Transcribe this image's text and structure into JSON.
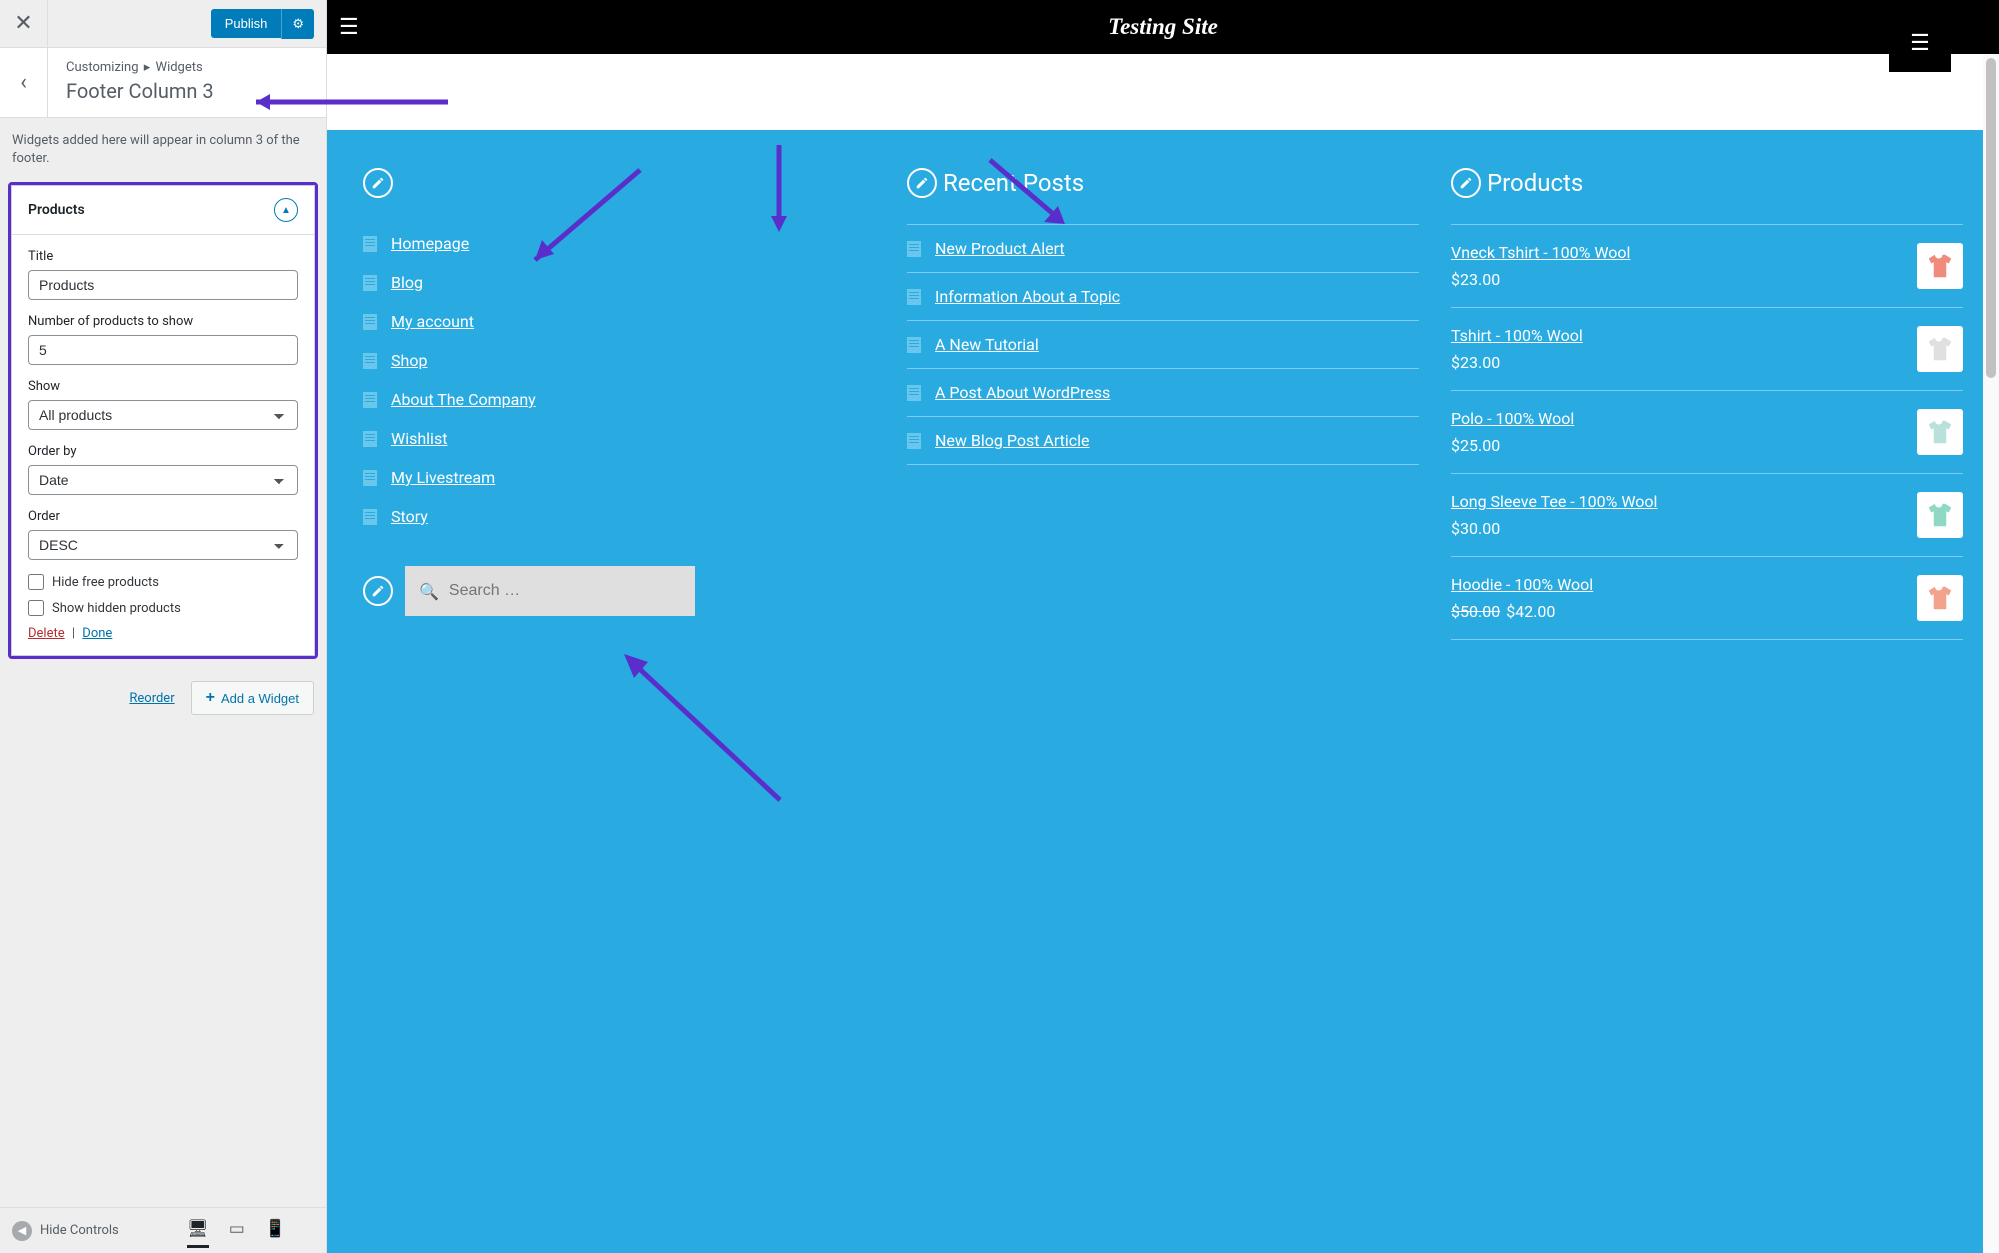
{
  "sidebar": {
    "publish_label": "Publish",
    "breadcrumb_root": "Customizing",
    "breadcrumb_parent": "Widgets",
    "section_title": "Footer Column 3",
    "description": "Widgets added here will appear in column 3 of the footer.",
    "widget": {
      "name": "Products",
      "fields": {
        "title_label": "Title",
        "title_value": "Products",
        "number_label": "Number of products to show",
        "number_value": "5",
        "show_label": "Show",
        "show_value": "All products",
        "orderby_label": "Order by",
        "orderby_value": "Date",
        "order_label": "Order",
        "order_value": "DESC",
        "hide_free_label": "Hide free products",
        "show_hidden_label": "Show hidden products"
      },
      "delete_label": "Delete",
      "done_label": "Done"
    },
    "reorder_label": "Reorder",
    "add_widget_label": "Add a Widget",
    "hide_controls_label": "Hide Controls"
  },
  "preview": {
    "site_title": "Testing Site",
    "col1": {
      "links": [
        "Homepage",
        "Blog",
        "My account",
        "Shop",
        "About The Company",
        "Wishlist",
        "My Livestream",
        "Story"
      ]
    },
    "col2": {
      "title": "Recent Posts",
      "posts": [
        "New Product Alert",
        "Information About a Topic",
        "A New Tutorial",
        "A Post About WordPress",
        "New Blog Post Article"
      ]
    },
    "col3": {
      "title": "Products",
      "products": [
        {
          "name": "Vneck Tshirt - 100% Wool",
          "price": "$23.00",
          "color": "#f08a7a"
        },
        {
          "name": "Tshirt - 100% Wool",
          "price": "$23.00",
          "color": "#e0e0e0"
        },
        {
          "name": "Polo - 100% Wool",
          "price": "$25.00",
          "color": "#b7e1da"
        },
        {
          "name": "Long Sleeve Tee - 100% Wool",
          "price": "$30.00",
          "color": "#8fd9c4"
        },
        {
          "name": "Hoodie - 100% Wool",
          "price_old": "$50.00",
          "price": "$42.00",
          "color": "#f3a28d"
        }
      ]
    },
    "search_placeholder": "Search …"
  }
}
